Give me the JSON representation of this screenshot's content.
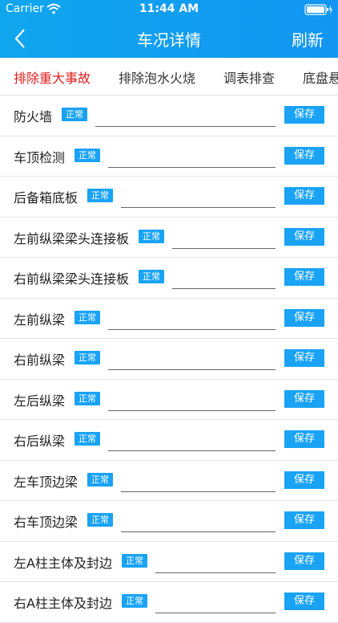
{
  "status_bar": {
    "carrier": "Carrier",
    "time": "11:44 AM"
  },
  "nav": {
    "title": "车况详情",
    "refresh": "刷新"
  },
  "tabs": [
    {
      "label": "排除重大事故",
      "active": true
    },
    {
      "label": "排除泡水火烧",
      "active": false
    },
    {
      "label": "调表排查",
      "active": false
    },
    {
      "label": "底盘悬",
      "active": false
    }
  ],
  "rows": [
    {
      "label": "防火墙",
      "status": "正常",
      "save": "保存"
    },
    {
      "label": "车顶检测",
      "status": "正常",
      "save": "保存"
    },
    {
      "label": "后备箱底板",
      "status": "正常",
      "save": "保存"
    },
    {
      "label": "左前纵梁梁头连接板",
      "status": "正常",
      "save": "保存"
    },
    {
      "label": "右前纵梁梁头连接板",
      "status": "正常",
      "save": "保存"
    },
    {
      "label": "左前纵梁",
      "status": "正常",
      "save": "保存"
    },
    {
      "label": "右前纵梁",
      "status": "正常",
      "save": "保存"
    },
    {
      "label": "左后纵梁",
      "status": "正常",
      "save": "保存"
    },
    {
      "label": "右后纵梁",
      "status": "正常",
      "save": "保存"
    },
    {
      "label": "左车顶边梁",
      "status": "正常",
      "save": "保存"
    },
    {
      "label": "右车顶边梁",
      "status": "正常",
      "save": "保存"
    },
    {
      "label": "左A柱主体及封边",
      "status": "正常",
      "save": "保存"
    },
    {
      "label": "右A柱主体及封边",
      "status": "正常",
      "save": "保存"
    }
  ],
  "colors": {
    "header": "#1296f2",
    "accent": "#1aa3f5",
    "active_tab": "#e02020"
  },
  "icons": {
    "back": "chevron-left-icon",
    "wifi": "wifi-icon",
    "battery": "battery-icon"
  }
}
